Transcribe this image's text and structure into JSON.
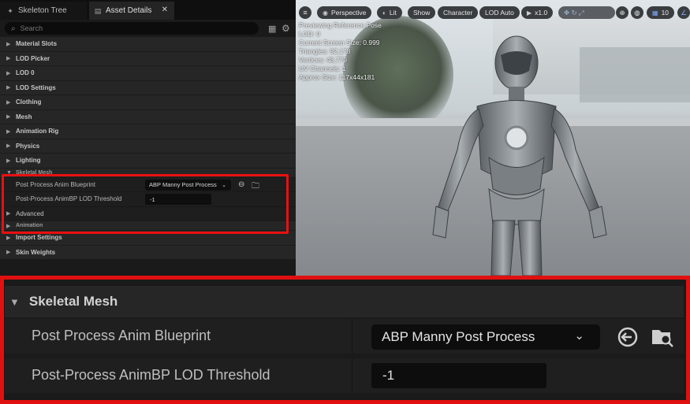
{
  "tabs": {
    "skeleton_tree": "Skeleton Tree",
    "asset_details": "Asset Details",
    "close_glyph": "✕"
  },
  "search": {
    "placeholder": "Search"
  },
  "categories_top": [
    "Material Slots",
    "LOD Picker",
    "LOD 0",
    "LOD Settings",
    "Clothing",
    "Mesh",
    "Animation Rig",
    "Physics",
    "Lighting"
  ],
  "skeletal_mesh": {
    "header": "Skeletal Mesh",
    "post_process_label": "Post Process Anim Blueprint",
    "post_process_value": "ABP Manny Post Process",
    "lod_threshold_label": "Post-Process AnimBP LOD Threshold",
    "lod_threshold_value": "-1",
    "advanced": "Advanced"
  },
  "categories_bottom": [
    "Animation",
    "Import Settings",
    "Skin Weights"
  ],
  "viewport": {
    "toolbar": {
      "perspective": "Perspective",
      "lit": "Lit",
      "show": "Show",
      "character": "Character",
      "lod": "LOD Auto",
      "speed": "x1.0",
      "grid_size": "10"
    },
    "stats": [
      "Previewing Reference Pose",
      "LOD: 0",
      "Current Screen Size: 0.999",
      "Triangles: 92,178",
      "Vertices: 48,779",
      "UV Channels: 1",
      "Approx Size: 117x44x181"
    ]
  },
  "zoom": {
    "header": "Skeletal Mesh",
    "post_process_label": "Post Process Anim Blueprint",
    "post_process_value": "ABP Manny Post Process",
    "lod_threshold_label": "Post-Process AnimBP LOD Threshold",
    "lod_threshold_value": "-1"
  },
  "colors": {
    "highlight": "#e11010",
    "panel_bg": "#1a1a1a",
    "category_bg": "#262626",
    "field_bg": "#0d0d0d"
  }
}
